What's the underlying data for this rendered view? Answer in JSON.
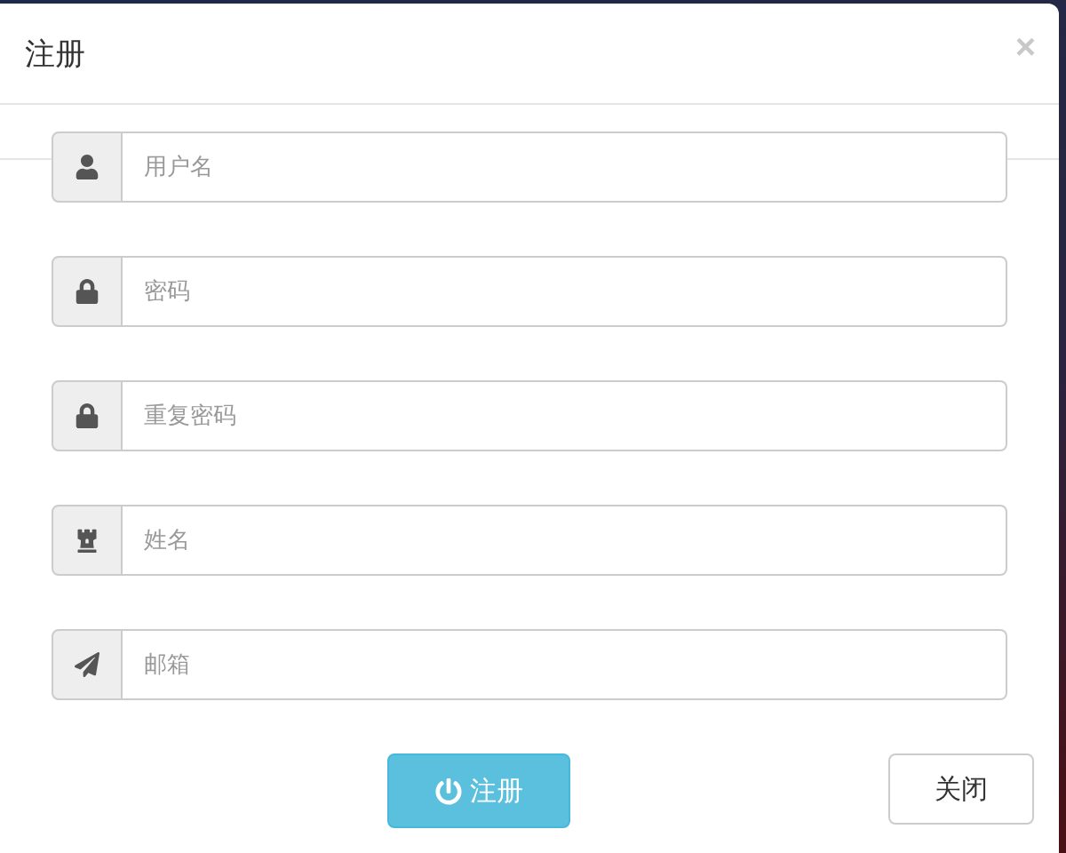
{
  "dialog": {
    "title": "注册",
    "close": "×"
  },
  "fields": [
    {
      "kind": "user",
      "placeholder": "用户名"
    },
    {
      "kind": "lock",
      "placeholder": "密码"
    },
    {
      "kind": "lock",
      "placeholder": "重复密码"
    },
    {
      "kind": "rook",
      "placeholder": "姓名"
    },
    {
      "kind": "plane",
      "placeholder": "邮箱"
    }
  ],
  "buttons": [
    {
      "kind": "primary",
      "label": "注册"
    },
    {
      "kind": "default",
      "label": "关闭"
    }
  ]
}
